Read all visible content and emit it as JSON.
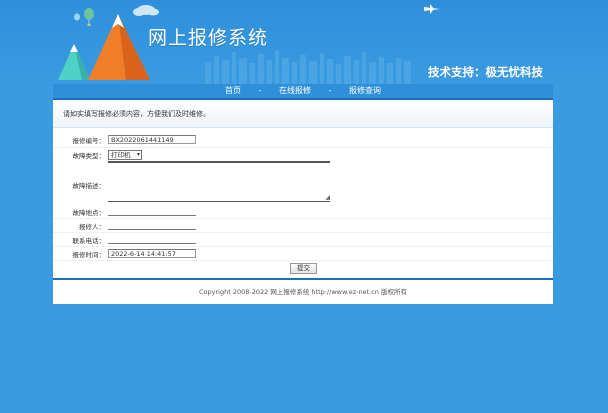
{
  "header": {
    "system_title": "网上报修系统",
    "support_text": "技术支持：极无忧科技"
  },
  "nav": {
    "items": [
      {
        "label": "首页"
      },
      {
        "label": "在线报修"
      },
      {
        "label": "报修查询"
      }
    ],
    "separator": "-"
  },
  "form": {
    "notice": "请如实填写报修必须内容，方便我们及时维修。",
    "fields": {
      "repair_no": {
        "label": "报修编号：",
        "value": "BX2022061441149"
      },
      "fault_type": {
        "label": "故障类型：",
        "value": "打印机"
      },
      "fault_desc": {
        "label": "故障描述：",
        "value": ""
      },
      "fault_location": {
        "label": "故障地点：",
        "value": ""
      },
      "reporter": {
        "label": "报修人：",
        "value": ""
      },
      "phone": {
        "label": "联系电话：",
        "value": ""
      },
      "report_time": {
        "label": "报修时间：",
        "value": "2022-6-14 14:41:57"
      }
    },
    "submit_label": "提交"
  },
  "footer": {
    "copyright": "Copyright 2008-2022 网上报修系统 http://www.ez-net.cn 版权所有"
  },
  "colors": {
    "background": "#3a9be0",
    "nav": "#2f8fd8",
    "accent_border": "#1c6fbd"
  }
}
